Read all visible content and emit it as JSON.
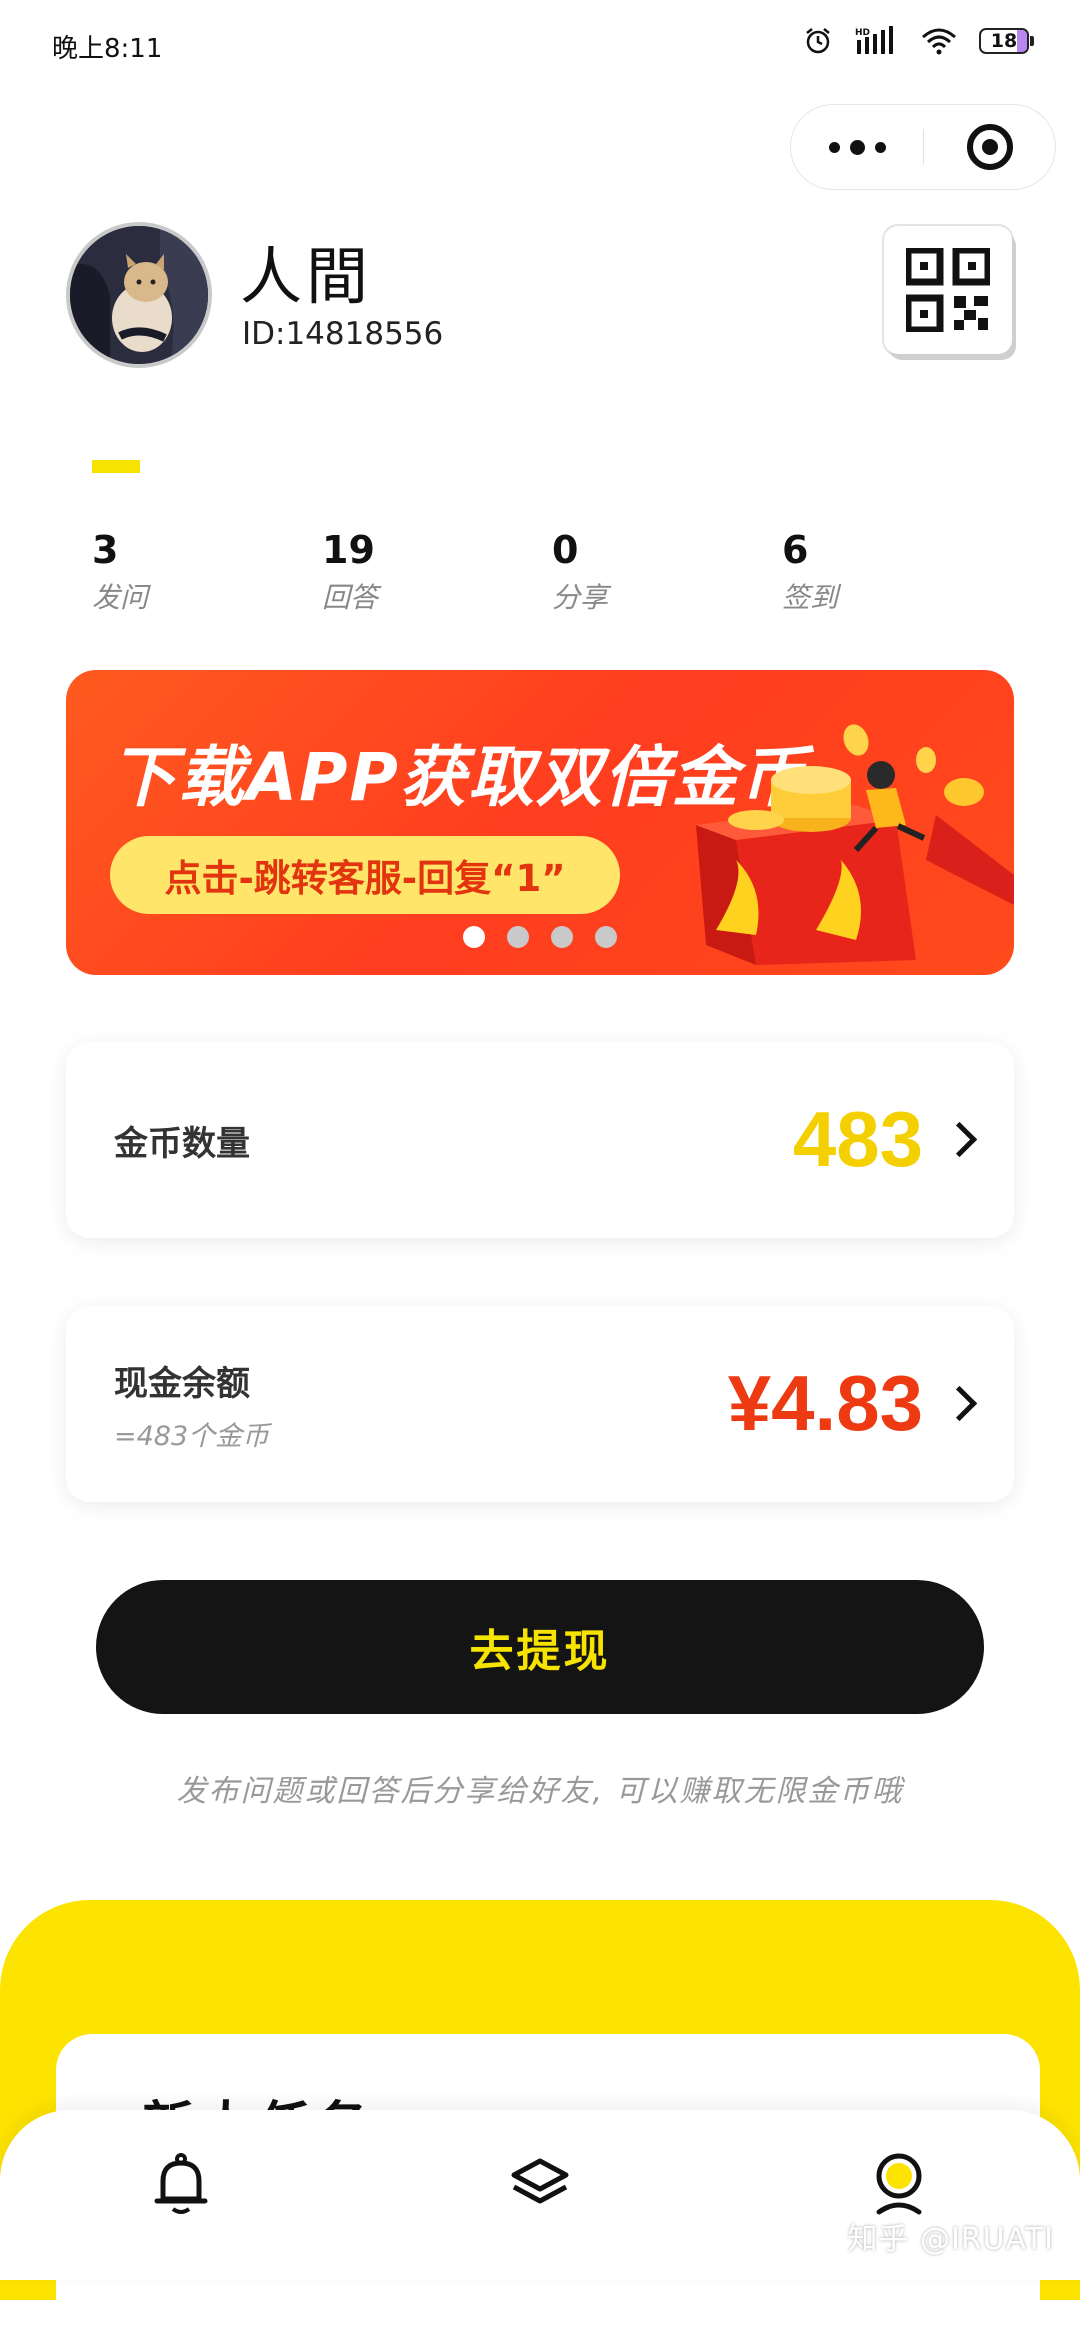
{
  "status_bar": {
    "time": "晚上8:11",
    "battery_level": "18"
  },
  "profile": {
    "name": "人間",
    "id_text": "ID:14818556"
  },
  "stats": [
    {
      "value": "3",
      "label": "发问"
    },
    {
      "value": "19",
      "label": "回答"
    },
    {
      "value": "0",
      "label": "分享"
    },
    {
      "value": "6",
      "label": "签到"
    }
  ],
  "banner": {
    "title": "下载APP获取双倍金币",
    "pill": "点击-跳转客服-回复“1”",
    "page_count": 4,
    "active_page": 1
  },
  "coins_card": {
    "label": "金币数量",
    "value": "483",
    "value_color": "#f5d000"
  },
  "cash_card": {
    "label": "现金余额",
    "sub": "=483个金币",
    "value": "¥4.83",
    "value_color": "#ee3a12"
  },
  "cta": {
    "label": "去提现"
  },
  "hint": "发布问题或回答后分享给好友, 可以赚取无限金币哦",
  "task_section": {
    "title": "新人任务"
  },
  "tabbar": {
    "icons": [
      "bell-icon",
      "layers-icon",
      "profile-icon"
    ]
  },
  "watermark": "知乎 @IRUATI",
  "colors": {
    "accent": "#fce300",
    "dark": "#141414",
    "banner": "#ff4a1c"
  }
}
